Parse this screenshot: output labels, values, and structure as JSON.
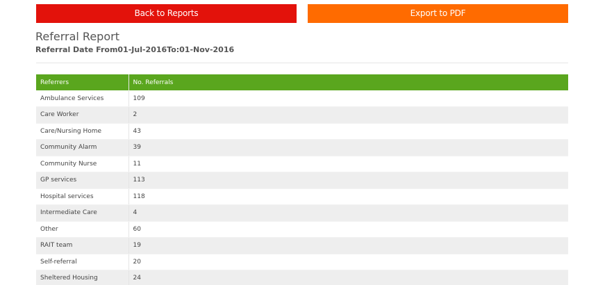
{
  "buttons": {
    "back_label": "Back to Reports",
    "export_label": "Export to PDF"
  },
  "report": {
    "title": "Referral Report",
    "date_range": "Referral Date From01-Jul-2016To:01-Nov-2016"
  },
  "table": {
    "headers": [
      "Referrers",
      "No. Referrals"
    ],
    "rows": [
      [
        "Ambulance Services",
        "109"
      ],
      [
        "Care Worker",
        "2"
      ],
      [
        "Care/Nursing Home",
        "43"
      ],
      [
        "Community Alarm",
        "39"
      ],
      [
        "Community Nurse",
        "11"
      ],
      [
        "GP services",
        "113"
      ],
      [
        "Hospital services",
        "118"
      ],
      [
        "Intermediate Care",
        "4"
      ],
      [
        "Other",
        "60"
      ],
      [
        "RAIT team",
        "19"
      ],
      [
        "Self-referral",
        "20"
      ],
      [
        "Sheltered Housing",
        "24"
      ]
    ]
  },
  "colors": {
    "back_button": "#e3120b",
    "export_button": "#ff6b00",
    "table_header": "#5aa61e",
    "row_stripe": "#eeeeee"
  }
}
